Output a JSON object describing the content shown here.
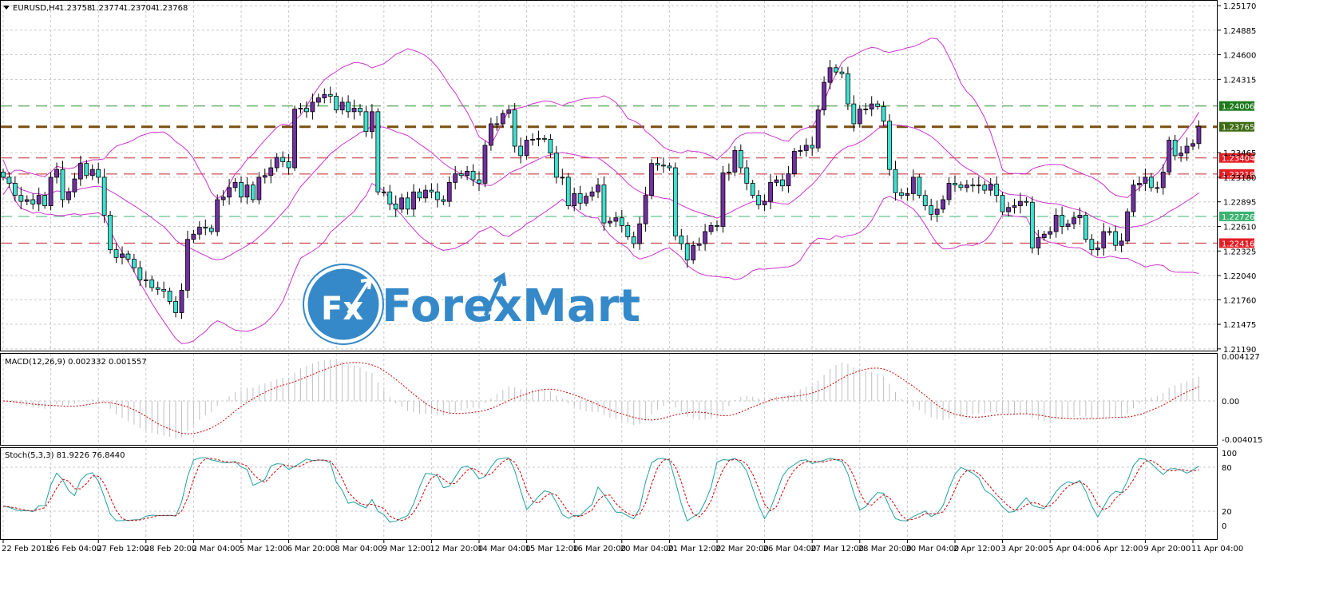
{
  "header": {
    "symbol": "EURUSD,H4",
    "open": "1.23758",
    "high": "1.23774",
    "low": "1.23704",
    "close": "1.23768"
  },
  "macd_panel": {
    "label": "MACD(12,26,9) 0.002332 0.001557",
    "axis": [
      "0.004127",
      "0.00",
      "-0.004015"
    ]
  },
  "stoch_panel": {
    "label": "Stoch(5,3,3) 81.9226 76.8440",
    "axis": [
      "100",
      "80",
      "20",
      "0"
    ]
  },
  "logo": {
    "mark": "Fx",
    "text": "ForexMart"
  },
  "colors": {
    "bull": "#7030a0",
    "bear": "#40e0d0",
    "bands": "#cc33cc",
    "macd_hist": "#c0c0c0",
    "signal": "#cc0000",
    "stoch_main": "#20a0a0"
  },
  "chart_data": {
    "type": "candlestick",
    "title": "EURUSD,H4",
    "price_axis_ticks": [
      "1.25170",
      "1.24885",
      "1.24600",
      "1.24315",
      "1.23465",
      "1.23180",
      "1.22895",
      "1.22610",
      "1.22325",
      "1.22040",
      "1.21760",
      "1.21475",
      "1.21190"
    ],
    "ylim": [
      1.2119,
      1.2517
    ],
    "time_labels": [
      "22 Feb 2018",
      "26 Feb 04:00",
      "27 Feb 12:00",
      "28 Feb 20:00",
      "2 Mar 04:00",
      "5 Mar 12:00",
      "6 Mar 20:00",
      "8 Mar 04:00",
      "9 Mar 12:00",
      "12 Mar 20:00",
      "14 Mar 04:00",
      "15 Mar 12:00",
      "16 Mar 20:00",
      "20 Mar 04:00",
      "21 Mar 12:00",
      "22 Mar 20:00",
      "26 Mar 04:00",
      "27 Mar 12:00",
      "28 Mar 20:00",
      "30 Mar 04:00",
      "2 Apr 12:00",
      "3 Apr 20:00",
      "5 Apr 04:00",
      "6 Apr 12:00",
      "9 Apr 20:00",
      "11 Apr 04:00"
    ],
    "bars_per_time_label": 8,
    "levels": [
      {
        "price": 1.24006,
        "label": "1.24006",
        "color": "#2e8b2e",
        "tag": "#1d7a1d",
        "style": "dash"
      },
      {
        "price": 1.23765,
        "label": "1.23765",
        "color": "#7a4f10",
        "tag": "#3d6b12",
        "style": "thick"
      },
      {
        "price": 1.23404,
        "label": "1.23404",
        "color": "#c0282d",
        "tag": "#e31e24",
        "style": "dash"
      },
      {
        "price": 1.23218,
        "label": "1.23218",
        "color": "#c0282d",
        "tag": "#e31e24",
        "style": "dash"
      },
      {
        "price": 1.22726,
        "label": "1.22726",
        "color": "#3cb371",
        "tag": "#3cb371",
        "style": "dash"
      },
      {
        "price": 1.22416,
        "label": "1.22416",
        "color": "#c0282d",
        "tag": "#e31e24",
        "style": "dash"
      }
    ],
    "closes": [
      1.2318,
      1.2311,
      1.2297,
      1.229,
      1.2292,
      1.2287,
      1.2297,
      1.2285,
      1.2318,
      1.2327,
      1.2292,
      1.2301,
      1.2316,
      1.2334,
      1.232,
      1.2327,
      1.2318,
      1.2274,
      1.2234,
      1.2225,
      1.2229,
      1.2223,
      1.2213,
      1.2199,
      1.2199,
      1.219,
      1.2188,
      1.2186,
      1.2174,
      1.2161,
      1.2187,
      1.2246,
      1.2252,
      1.226,
      1.2259,
      1.2255,
      1.2292,
      1.2295,
      1.2306,
      1.2312,
      1.2295,
      1.2309,
      1.2292,
      1.2318,
      1.232,
      1.2329,
      1.2341,
      1.2336,
      1.2329,
      1.2397,
      1.2398,
      1.2394,
      1.2405,
      1.241,
      1.2414,
      1.2412,
      1.2396,
      1.2405,
      1.2394,
      1.2398,
      1.2394,
      1.2371,
      1.2394,
      1.2301,
      1.2301,
      1.2287,
      1.2281,
      1.2294,
      1.2281,
      1.2301,
      1.2294,
      1.2303,
      1.2301,
      1.2292,
      1.229,
      1.2312,
      1.2322,
      1.232,
      1.2325,
      1.2315,
      1.2311,
      1.2355,
      1.238,
      1.238,
      1.2392,
      1.2396,
      1.2354,
      1.2343,
      1.2361,
      1.2362,
      1.2363,
      1.2362,
      1.2346,
      1.2318,
      1.2318,
      1.2285,
      1.2299,
      1.2288,
      1.2296,
      1.2301,
      1.2309,
      1.2265,
      1.2267,
      1.2271,
      1.2262,
      1.2249,
      1.2241,
      1.2264,
      1.2297,
      1.2334,
      1.2332,
      1.2331,
      1.2329,
      1.225,
      1.2241,
      1.2222,
      1.2239,
      1.2241,
      1.2255,
      1.2262,
      1.2261,
      1.2323,
      1.2324,
      1.2349,
      1.2329,
      1.2311,
      1.2297,
      1.2286,
      1.229,
      1.2312,
      1.2315,
      1.2308,
      1.2322,
      1.2348,
      1.2349,
      1.2355,
      1.2352,
      1.2396,
      1.2428,
      1.2445,
      1.244,
      1.2438,
      1.2403,
      1.238,
      1.2397,
      1.2397,
      1.2403,
      1.24,
      1.2383,
      1.2327,
      1.23,
      1.2297,
      1.2299,
      1.2318,
      1.2297,
      1.2285,
      1.2275,
      1.2281,
      1.2292,
      1.2311,
      1.2309,
      1.2306,
      1.2309,
      1.2308,
      1.2309,
      1.2303,
      1.231,
      1.2297,
      1.2278,
      1.2283,
      1.2285,
      1.229,
      1.2289,
      1.2236,
      1.2248,
      1.2252,
      1.2255,
      1.2274,
      1.2261,
      1.2264,
      1.2271,
      1.2274,
      1.2246,
      1.2234,
      1.2236,
      1.2255,
      1.2255,
      1.2239,
      1.2244,
      1.2278,
      1.2309,
      1.2311,
      1.2318,
      1.2306,
      1.2306,
      1.2324,
      1.2361,
      1.2343,
      1.2346,
      1.2354,
      1.2357,
      1.2377
    ],
    "indicators": [
      "Bollinger Bands(20,2)",
      "MACD(12,26,9)",
      "Stoch(5,3,3)"
    ]
  }
}
